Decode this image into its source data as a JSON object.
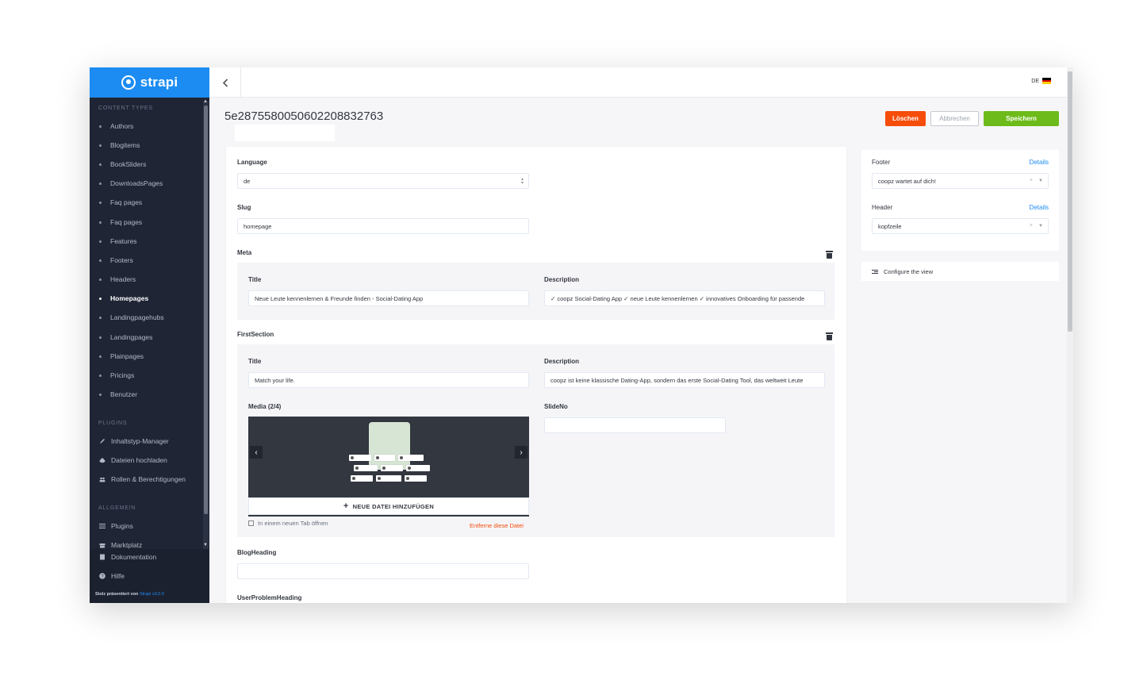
{
  "brand": {
    "name": "strapi"
  },
  "sidebar": {
    "content_types_heading": "CONTENT TYPES",
    "content_types": [
      {
        "label": "Authors"
      },
      {
        "label": "Blogitems"
      },
      {
        "label": "BookSliders"
      },
      {
        "label": "DownloadsPages"
      },
      {
        "label": "Faq pages"
      },
      {
        "label": "Faq pages"
      },
      {
        "label": "Features"
      },
      {
        "label": "Footers"
      },
      {
        "label": "Headers"
      },
      {
        "label": "Homepages"
      },
      {
        "label": "Landingpagehubs"
      },
      {
        "label": "Landingpages"
      },
      {
        "label": "Plainpages"
      },
      {
        "label": "Pricings"
      },
      {
        "label": "Benutzer"
      }
    ],
    "active_item": "Homepages",
    "plugins_heading": "PLUGINS",
    "plugins": [
      {
        "label": "Inhaltstyp-Manager",
        "icon": "pencil-icon"
      },
      {
        "label": "Dateien hochladen",
        "icon": "cloud-upload-icon"
      },
      {
        "label": "Rollen & Berechtigungen",
        "icon": "users-icon"
      }
    ],
    "general_heading": "ALLGEMEIN",
    "general": [
      {
        "label": "Plugins",
        "icon": "list-icon"
      },
      {
        "label": "Marktplatz",
        "icon": "shop-icon"
      },
      {
        "label": "Dokumentation",
        "icon": "book-icon"
      },
      {
        "label": "Hilfe",
        "icon": "question-icon"
      }
    ],
    "credit_prefix": "Stolz präsentiert von",
    "credit_link": "Strapi v3.0.0"
  },
  "topbar": {
    "lang_code": "DE"
  },
  "page": {
    "title": "5e287558005060220883​2763",
    "buttons": {
      "delete": "Löschen",
      "cancel": "Abbrechen",
      "save": "Speichern"
    }
  },
  "form": {
    "language": {
      "label": "Language",
      "value": "de"
    },
    "slug": {
      "label": "Slug",
      "value": "homepage"
    },
    "meta": {
      "label": "Meta",
      "title_label": "Title",
      "title_value": "Neue Leute kennenlernen & Freunde finden - Social-Dating App",
      "description_label": "Description",
      "description_value": "✓ coopz Social-Dating App ✓ neue Leute kennenlernen ✓ innovatives Onboarding für passende"
    },
    "first_section": {
      "label": "FirstSection",
      "title_label": "Title",
      "title_value": "Match your life.",
      "description_label": "Description",
      "description_value": "coopz ist keine klassische Dating-App, sondern das erste Social-Dating Tool, das weltweit Leute",
      "media_label": "Media (2/4)",
      "add_file": "NEUE DATEI HINZUFÜGEN",
      "open_new_tab": "In einem neuen Tab öffnen",
      "remove_file": "Entferne diese Datei",
      "slideno_label": "SlideNo",
      "slideno_value": ""
    },
    "blog_heading": {
      "label": "BlogHeading",
      "value": ""
    },
    "user_problem_heading": {
      "label": "UserProblemHeading"
    }
  },
  "relations": {
    "footer": {
      "label": "Footer",
      "details": "Details",
      "value": "coopz wartet auf dich!"
    },
    "header": {
      "label": "Header",
      "details": "Details",
      "value": "kopfzeile"
    },
    "configure_view": "Configure the view"
  },
  "colors": {
    "brand_blue": "#1c8cf2",
    "sidebar_bg": "#1f2535",
    "delete_red": "#f64d0a",
    "save_green": "#6dbb1a"
  }
}
